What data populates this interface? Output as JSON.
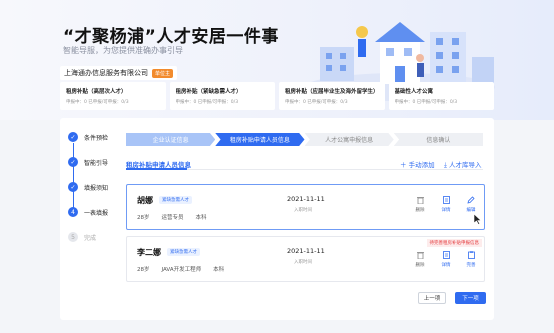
{
  "header": {
    "title": "“才聚杨浦”人才安居一件事",
    "subtitle": "智能导服，为您提供准确办事引导",
    "company": "上海通办信息服务有限公司",
    "company_badge": "单位主"
  },
  "subsidies": [
    {
      "title": "租房补贴（高层次人才）",
      "stats": "申报中：0    已申报/可申报：0/3"
    },
    {
      "title": "租房补贴（紧缺急需人才）",
      "stats": "申报中：0    已申报/可申报：0/3"
    },
    {
      "title": "租房补贴（应届毕业生及海外留学生）",
      "stats": "申报中：0    已申报/可申报：0/3"
    },
    {
      "title": "基础性人才公寓",
      "stats": "申报中：0    已申报/可申报：0/3"
    }
  ],
  "steps": [
    {
      "label": "条件预检",
      "state": "done",
      "mark": "✓"
    },
    {
      "label": "智能引导",
      "state": "done",
      "mark": "✓"
    },
    {
      "label": "填报须知",
      "state": "done",
      "mark": "✓"
    },
    {
      "label": "一表填报",
      "state": "active",
      "mark": "4"
    },
    {
      "label": "完成",
      "state": "todo",
      "mark": "5"
    }
  ],
  "progress": [
    {
      "label": "企业认证信息",
      "state": "done"
    },
    {
      "label": "租房补贴申请人员信息",
      "state": "active"
    },
    {
      "label": "人才公寓申报信息",
      "state": "todo"
    },
    {
      "label": "信息确认",
      "state": "todo"
    }
  ],
  "section": {
    "title": "租房补贴申请人员信息",
    "add_label": "手动添加",
    "import_label": "人才库导入"
  },
  "people": [
    {
      "name": "胡娜",
      "tag": "紧缺急需人才",
      "age": "28岁",
      "job": "运营专员",
      "edu": "本科",
      "date": "2021-11-11",
      "date_label": "入职时间",
      "warning": "",
      "actions": [
        "删除",
        "详情",
        "编辑"
      ]
    },
    {
      "name": "李二娜",
      "tag": "紧缺急需人才",
      "age": "28岁",
      "job": "JAVA开发工程师",
      "edu": "本科",
      "date": "2021-11-11",
      "date_label": "入职时间",
      "warning": "待完善租房补贴申报信息",
      "actions": [
        "删除",
        "详情",
        "完善"
      ]
    }
  ],
  "buttons": {
    "prev": "上一项",
    "next": "下一项"
  },
  "colors": {
    "primary": "#2f6bf0",
    "badge": "#f28b2d",
    "warning": "#e4393c"
  }
}
